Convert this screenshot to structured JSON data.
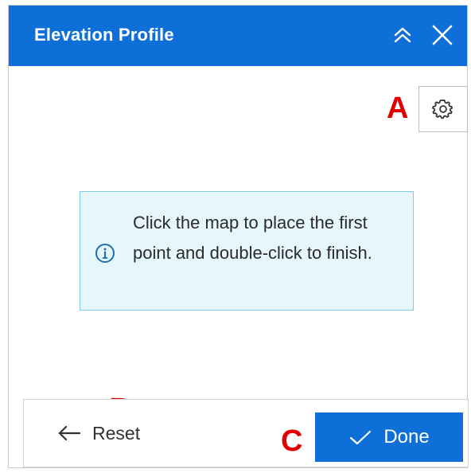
{
  "panel": {
    "title": "Elevation Profile",
    "collapse_icon": "double-chevron-up-icon",
    "close_icon": "close-icon"
  },
  "toolbar": {
    "settings_icon": "gear-icon"
  },
  "notice": {
    "icon": "info-icon",
    "message": "Click the map to place the first point and double-click to finish."
  },
  "footer": {
    "reset_label": "Reset",
    "reset_icon": "arrow-left-icon",
    "done_label": "Done",
    "done_icon": "check-icon"
  },
  "annotations": {
    "a": "A",
    "b": "B",
    "c": "C"
  },
  "colors": {
    "header_bg": "#0f6fd8",
    "primary_button": "#0f6fd8",
    "notice_bg": "#e6f6fd",
    "notice_border": "#7ecbe8",
    "annotation": "#e00000"
  }
}
